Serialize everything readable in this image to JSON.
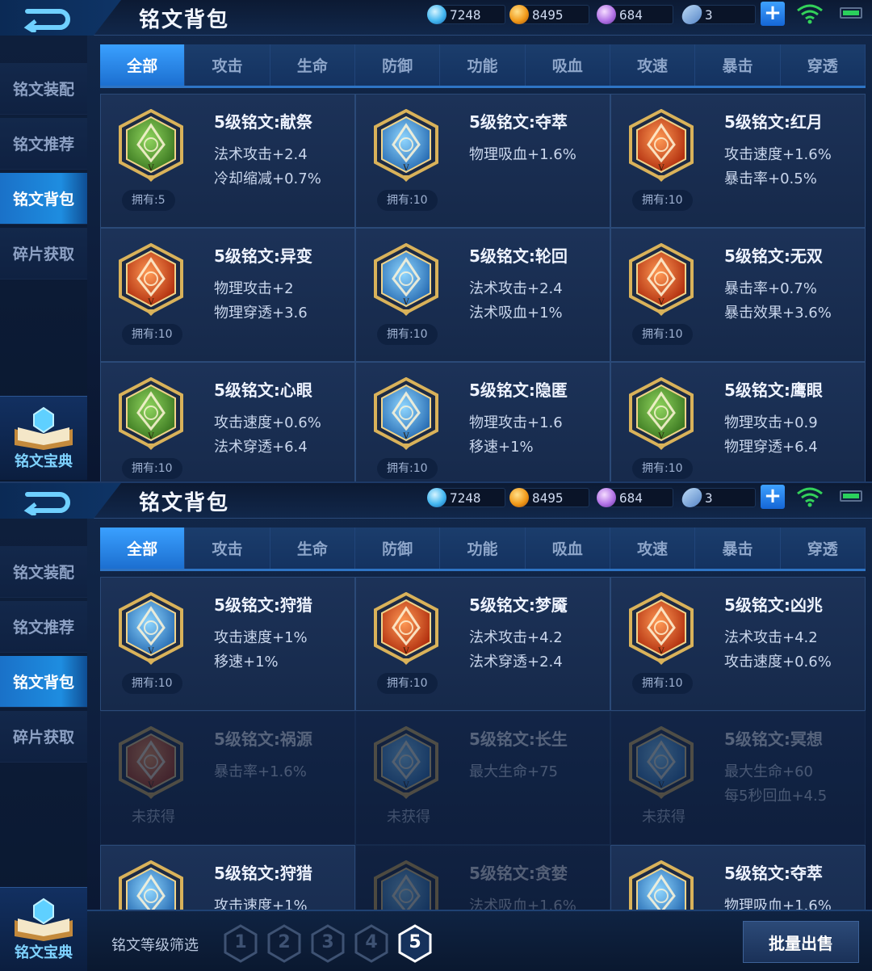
{
  "panels": [
    {
      "title": "铭文背包",
      "resources": {
        "diamond": "7248",
        "gold": "8495",
        "purple": "684",
        "card": "3"
      },
      "sidebar": [
        "铭文装配",
        "铭文推荐",
        "铭文背包",
        "碎片获取"
      ],
      "sidebar_active": 2,
      "codex_label": "铭文宝典",
      "tabs": [
        "全部",
        "攻击",
        "生命",
        "防御",
        "功能",
        "吸血",
        "攻速",
        "暴击",
        "穿透"
      ],
      "active_tab": 0,
      "runes": [
        {
          "name": "5级铭文:献祭",
          "stat1": "法术攻击+2.4",
          "stat2": "冷却缩减+0.7%",
          "owned": "拥有:5",
          "color": "green",
          "obtained": true
        },
        {
          "name": "5级铭文:夺萃",
          "stat1": "物理吸血+1.6%",
          "stat2": "",
          "owned": "拥有:10",
          "color": "blue",
          "obtained": true
        },
        {
          "name": "5级铭文:红月",
          "stat1": "攻击速度+1.6%",
          "stat2": "暴击率+0.5%",
          "owned": "拥有:10",
          "color": "red",
          "obtained": true
        },
        {
          "name": "5级铭文:异变",
          "stat1": "物理攻击+2",
          "stat2": "物理穿透+3.6",
          "owned": "拥有:10",
          "color": "red",
          "obtained": true
        },
        {
          "name": "5级铭文:轮回",
          "stat1": "法术攻击+2.4",
          "stat2": "法术吸血+1%",
          "owned": "拥有:10",
          "color": "blue",
          "obtained": true
        },
        {
          "name": "5级铭文:无双",
          "stat1": "暴击率+0.7%",
          "stat2": "暴击效果+3.6%",
          "owned": "拥有:10",
          "color": "red",
          "obtained": true
        },
        {
          "name": "5级铭文:心眼",
          "stat1": "攻击速度+0.6%",
          "stat2": "法术穿透+6.4",
          "owned": "拥有:10",
          "color": "green",
          "obtained": true
        },
        {
          "name": "5级铭文:隐匿",
          "stat1": "物理攻击+1.6",
          "stat2": "移速+1%",
          "owned": "拥有:10",
          "color": "blue",
          "obtained": true
        },
        {
          "name": "5级铭文:鹰眼",
          "stat1": "物理攻击+0.9",
          "stat2": "物理穿透+6.4",
          "owned": "拥有:10",
          "color": "green",
          "obtained": true
        }
      ]
    },
    {
      "title": "铭文背包",
      "resources": {
        "diamond": "7248",
        "gold": "8495",
        "purple": "684",
        "card": "3"
      },
      "sidebar": [
        "铭文装配",
        "铭文推荐",
        "铭文背包",
        "碎片获取"
      ],
      "sidebar_active": 2,
      "codex_label": "铭文宝典",
      "tabs": [
        "全部",
        "攻击",
        "生命",
        "防御",
        "功能",
        "吸血",
        "攻速",
        "暴击",
        "穿透"
      ],
      "active_tab": 0,
      "runes": [
        {
          "name": "5级铭文:狩猎",
          "stat1": "攻击速度+1%",
          "stat2": "移速+1%",
          "owned": "拥有:10",
          "color": "blue",
          "obtained": true
        },
        {
          "name": "5级铭文:梦魇",
          "stat1": "法术攻击+4.2",
          "stat2": "法术穿透+2.4",
          "owned": "拥有:10",
          "color": "red",
          "obtained": true
        },
        {
          "name": "5级铭文:凶兆",
          "stat1": "法术攻击+4.2",
          "stat2": "攻击速度+0.6%",
          "owned": "拥有:10",
          "color": "red",
          "obtained": true
        },
        {
          "name": "5级铭文:祸源",
          "stat1": "暴击率+1.6%",
          "stat2": "",
          "owned": "未获得",
          "color": "red",
          "obtained": false
        },
        {
          "name": "5级铭文:长生",
          "stat1": "最大生命+75",
          "stat2": "",
          "owned": "未获得",
          "color": "blue",
          "obtained": false
        },
        {
          "name": "5级铭文:冥想",
          "stat1": "最大生命+60",
          "stat2": "每5秒回血+4.5",
          "owned": "未获得",
          "color": "blue",
          "obtained": false
        },
        {
          "name": "5级铭文:狩猎",
          "stat1": "攻击速度+1%",
          "stat2": "",
          "owned": "",
          "color": "blue",
          "obtained": true
        },
        {
          "name": "5级铭文:贪婪",
          "stat1": "法术吸血+1.6%",
          "stat2": "",
          "owned": "",
          "color": "blue",
          "obtained": false
        },
        {
          "name": "5级铭文:夺萃",
          "stat1": "物理吸血+1.6%",
          "stat2": "",
          "owned": "",
          "color": "blue",
          "obtained": true
        }
      ],
      "bottom": {
        "filter_label": "铭文等级筛选",
        "levels": [
          "1",
          "2",
          "3",
          "4",
          "5"
        ],
        "active_level": 4,
        "sell_label": "批量出售"
      }
    }
  ],
  "colors": {
    "green": "#5fa83a",
    "blue": "#3c94d6",
    "red": "#d4451d",
    "gold": "#d9b25a",
    "active": "#1e8de0"
  }
}
